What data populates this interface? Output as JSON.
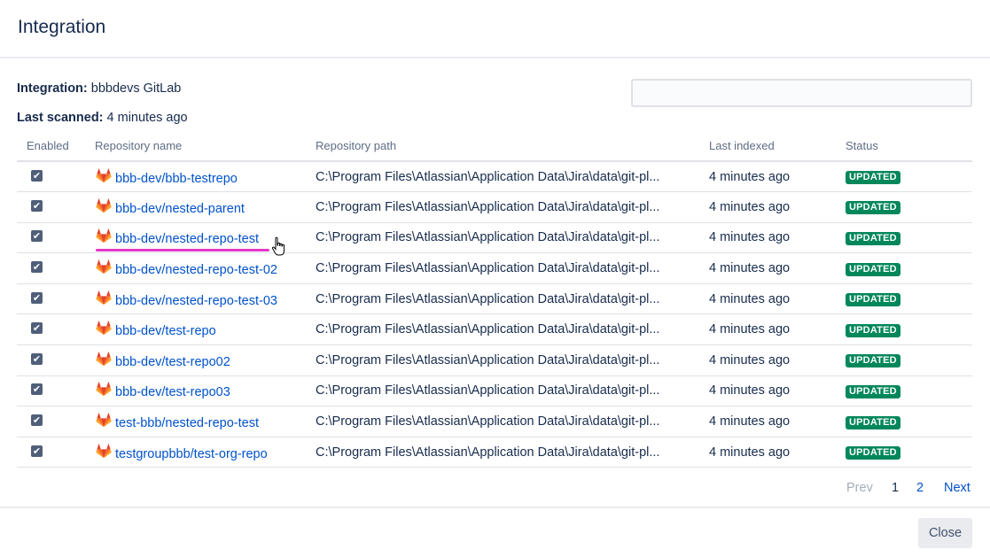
{
  "dialog": {
    "title": "Integration",
    "integration_label": "Integration:",
    "integration_value": "bbbdevs GitLab",
    "last_scanned_label": "Last scanned:",
    "last_scanned_value": "4 minutes ago",
    "search": {
      "value": "",
      "placeholder": ""
    },
    "close_label": "Close"
  },
  "table": {
    "headers": [
      "Enabled",
      "Repository name",
      "Repository path",
      "Last indexed",
      "Status"
    ],
    "rows": [
      {
        "enabled": true,
        "name": "bbb-dev/bbb-testrepo",
        "path": "C:\\Program Files\\Atlassian\\Application Data\\Jira\\data\\git-pl...",
        "last_indexed": "4 minutes ago",
        "status": "UPDATED"
      },
      {
        "enabled": true,
        "name": "bbb-dev/nested-parent",
        "path": "C:\\Program Files\\Atlassian\\Application Data\\Jira\\data\\git-pl...",
        "last_indexed": "4 minutes ago",
        "status": "UPDATED"
      },
      {
        "enabled": true,
        "name": "bbb-dev/nested-repo-test",
        "path": "C:\\Program Files\\Atlassian\\Application Data\\Jira\\data\\git-pl...",
        "last_indexed": "4 minutes ago",
        "status": "UPDATED"
      },
      {
        "enabled": true,
        "name": "bbb-dev/nested-repo-test-02",
        "path": "C:\\Program Files\\Atlassian\\Application Data\\Jira\\data\\git-pl...",
        "last_indexed": "4 minutes ago",
        "status": "UPDATED"
      },
      {
        "enabled": true,
        "name": "bbb-dev/nested-repo-test-03",
        "path": "C:\\Program Files\\Atlassian\\Application Data\\Jira\\data\\git-pl...",
        "last_indexed": "4 minutes ago",
        "status": "UPDATED"
      },
      {
        "enabled": true,
        "name": "bbb-dev/test-repo",
        "path": "C:\\Program Files\\Atlassian\\Application Data\\Jira\\data\\git-pl...",
        "last_indexed": "4 minutes ago",
        "status": "UPDATED"
      },
      {
        "enabled": true,
        "name": "bbb-dev/test-repo02",
        "path": "C:\\Program Files\\Atlassian\\Application Data\\Jira\\data\\git-pl...",
        "last_indexed": "4 minutes ago",
        "status": "UPDATED"
      },
      {
        "enabled": true,
        "name": "bbb-dev/test-repo03",
        "path": "C:\\Program Files\\Atlassian\\Application Data\\Jira\\data\\git-pl...",
        "last_indexed": "4 minutes ago",
        "status": "UPDATED"
      },
      {
        "enabled": true,
        "name": "test-bbb/nested-repo-test",
        "path": "C:\\Program Files\\Atlassian\\Application Data\\Jira\\data\\git-pl...",
        "last_indexed": "4 minutes ago",
        "status": "UPDATED"
      },
      {
        "enabled": true,
        "name": "testgroupbbb/test-org-repo",
        "path": "C:\\Program Files\\Atlassian\\Application Data\\Jira\\data\\git-pl...",
        "last_indexed": "4 minutes ago",
        "status": "UPDATED"
      }
    ],
    "repo_icon": "gitlab-icon",
    "checkbox_glyph": "✔"
  },
  "pagination": {
    "prev": "Prev",
    "pages": [
      "1",
      "2"
    ],
    "current": "1",
    "next": "Next"
  },
  "colors": {
    "link": "#0052cc",
    "status_updated": "#00875a",
    "hover_underline": "#e535c5",
    "text": "#172b4d",
    "muted": "#5e6c84"
  }
}
